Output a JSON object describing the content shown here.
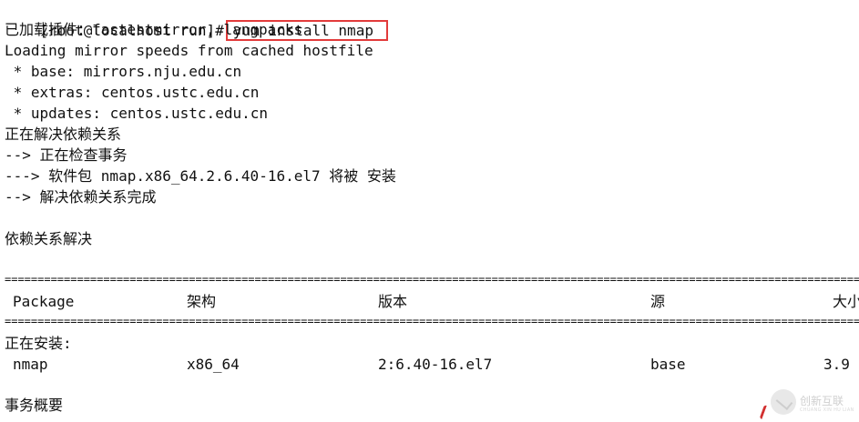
{
  "terminal": {
    "prompt": "[root@localhost run]#",
    "command": "yum install nmap",
    "output_lines": [
      "已加载插件：fastestmirror, langpacks",
      "Loading mirror speeds from cached hostfile",
      " * base: mirrors.nju.edu.cn",
      " * extras: centos.ustc.edu.cn",
      " * updates: centos.ustc.edu.cn",
      "正在解决依赖关系",
      "--> 正在检查事务",
      "---> 软件包 nmap.x86_64.2.6.40-16.el7 将被 安装",
      "--> 解决依赖关系完成",
      "",
      "依赖关系解决"
    ],
    "separator": "=============================================================================================================================================================================================================",
    "table": {
      "headers": {
        "package": "Package",
        "arch": "架构",
        "version": "版本",
        "repo": "源",
        "size": "大小"
      },
      "section_title": "正在安装:",
      "rows": [
        {
          "package": "nmap",
          "arch": "x86_64",
          "version": "2:6.40-16.el7",
          "repo": "base",
          "size": "3.9"
        }
      ]
    },
    "summary_title": "事务概要"
  },
  "watermark": {
    "text": "创新互联",
    "subtext": "CHUANG XIN HU LIAN"
  },
  "colors": {
    "highlight_border": "#e23b3b",
    "text": "#111111",
    "background": "#ffffff"
  }
}
